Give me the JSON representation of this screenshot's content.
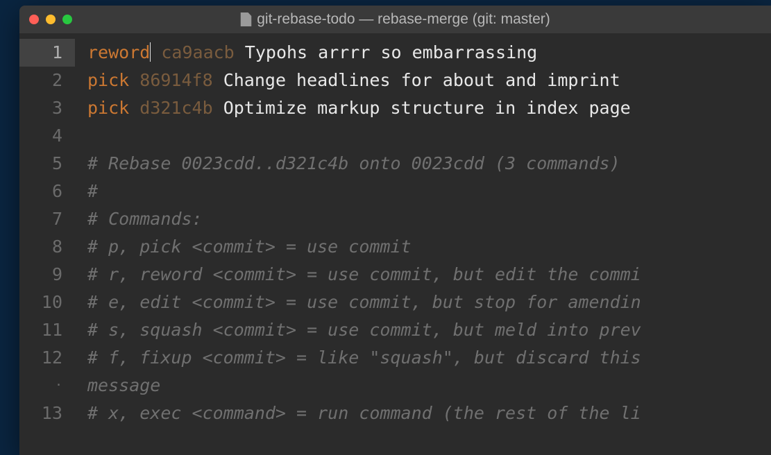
{
  "window": {
    "title": "git-rebase-todo — rebase-merge (git: master)"
  },
  "gutter": {
    "lines": [
      "1",
      "2",
      "3",
      "4",
      "5",
      "6",
      "7",
      "8",
      "9",
      "10",
      "11",
      "12",
      "·",
      "13"
    ],
    "activeIndex": 0,
    "dotIndex": 12
  },
  "commits": [
    {
      "cmd": "reword",
      "hash": "ca9aacb",
      "msg": "Typohs arrrr so embarrassing",
      "cursor": true
    },
    {
      "cmd": "pick",
      "hash": "86914f8",
      "msg": "Change headlines for about and imprint"
    },
    {
      "cmd": "pick",
      "hash": "d321c4b",
      "msg": "Optimize markup structure in index page"
    }
  ],
  "comments": [
    "",
    "# Rebase 0023cdd..d321c4b onto 0023cdd (3 commands)",
    "#",
    "# Commands:",
    "# p, pick <commit> = use commit",
    "# r, reword <commit> = use commit, but edit the commi",
    "# e, edit <commit> = use commit, but stop for amendin",
    "# s, squash <commit> = use commit, but meld into prev",
    "# f, fixup <commit> = like \"squash\", but discard this",
    "message",
    "# x, exec <command> = run command (the rest of the li"
  ]
}
